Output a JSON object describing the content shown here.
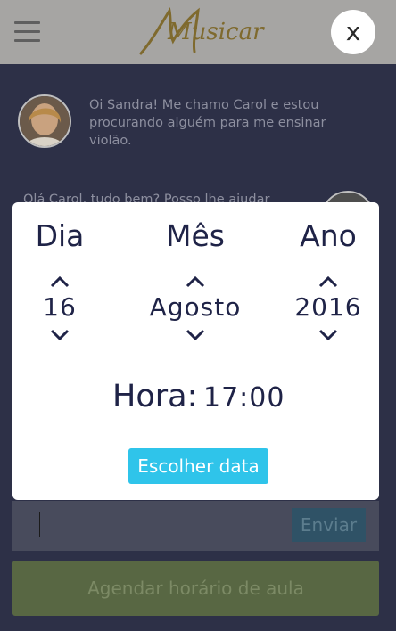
{
  "header": {
    "logo_text": "Musicar",
    "close_label": "x"
  },
  "chat": {
    "messages": [
      {
        "text": "Oi Sandra! Me chamo Carol e estou procurando alguém para me ensinar violão."
      },
      {
        "text": "Olá Carol, tudo bem? Posso lhe ajudar"
      }
    ],
    "send_label": "Enviar",
    "schedule_label": "Agendar horário de aula"
  },
  "picker": {
    "day_label": "Dia",
    "month_label": "Mês",
    "year_label": "Ano",
    "day_value": "16",
    "month_value": "Agosto",
    "year_value": "2016",
    "hour_label": "Hora:",
    "hour_value": "17:00",
    "choose_label": "Escolher data"
  },
  "colors": {
    "header_bg": "#a6a5a3",
    "chat_bg": "#2d3047",
    "accent": "#2fc4ea",
    "text_dark": "#1f2347",
    "logo": "#7f6a2e"
  }
}
